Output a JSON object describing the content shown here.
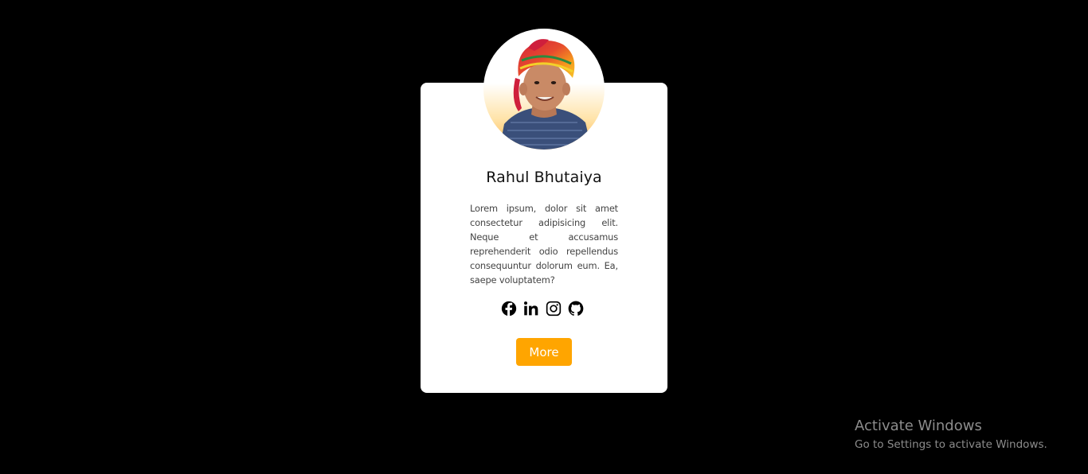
{
  "profile": {
    "name": "Rahul Bhutaiya",
    "bio": "Lorem ipsum, dolor sit amet consectetur adipisicing elit. Neque et accusamus reprehenderit odio repellendus consequuntur dolorum eum. Ea, saepe voluptatem?",
    "more_label": "More"
  },
  "socials": [
    {
      "icon": "facebook-icon"
    },
    {
      "icon": "linkedin-icon"
    },
    {
      "icon": "instagram-icon"
    },
    {
      "icon": "github-icon"
    }
  ],
  "windows_watermark": {
    "title": "Activate Windows",
    "subtitle": "Go to Settings to activate Windows."
  },
  "colors": {
    "background": "#000000",
    "card": "#ffffff",
    "accent": "#ffa500",
    "text": "#111111"
  }
}
